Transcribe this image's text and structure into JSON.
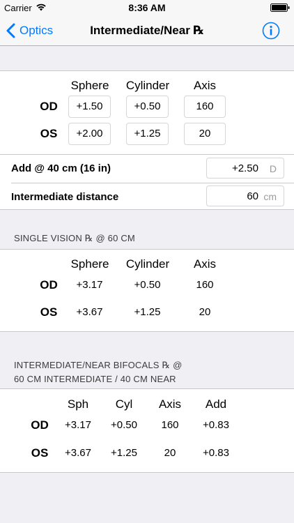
{
  "status": {
    "carrier": "Carrier",
    "time": "8:36 AM"
  },
  "nav": {
    "back_label": "Optics",
    "title": "Intermediate/Near ℞"
  },
  "input": {
    "headers": [
      "Sphere",
      "Cylinder",
      "Axis"
    ],
    "rows": [
      {
        "eye": "OD",
        "sphere": "+1.50",
        "cylinder": "+0.50",
        "axis": "160"
      },
      {
        "eye": "OS",
        "sphere": "+2.00",
        "cylinder": "+1.25",
        "axis": "20"
      }
    ],
    "add": {
      "label": "Add @ 40 cm (16 in)",
      "value": "+2.50",
      "unit": "D"
    },
    "intermediate": {
      "label": "Intermediate distance",
      "value": "60",
      "unit": "cm"
    }
  },
  "single_vision": {
    "header": "SINGLE VISION ℞ @ 60 CM",
    "headers": [
      "Sphere",
      "Cylinder",
      "Axis"
    ],
    "rows": [
      {
        "eye": "OD",
        "sphere": "+3.17",
        "cylinder": "+0.50",
        "axis": "160"
      },
      {
        "eye": "OS",
        "sphere": "+3.67",
        "cylinder": "+1.25",
        "axis": "20"
      }
    ]
  },
  "bifocals": {
    "header_line1": "INTERMEDIATE/NEAR BIFOCALS ℞ @",
    "header_line2": "60 CM INTERMEDIATE / 40 CM NEAR",
    "headers": [
      "Sph",
      "Cyl",
      "Axis",
      "Add"
    ],
    "rows": [
      {
        "eye": "OD",
        "sph": "+3.17",
        "cyl": "+0.50",
        "axis": "160",
        "add": "+0.83"
      },
      {
        "eye": "OS",
        "sph": "+3.67",
        "cyl": "+1.25",
        "axis": "20",
        "add": "+0.83"
      }
    ]
  },
  "colors": {
    "accent": "#007aff",
    "background": "#efeff4",
    "separator": "#c8c7cc"
  }
}
